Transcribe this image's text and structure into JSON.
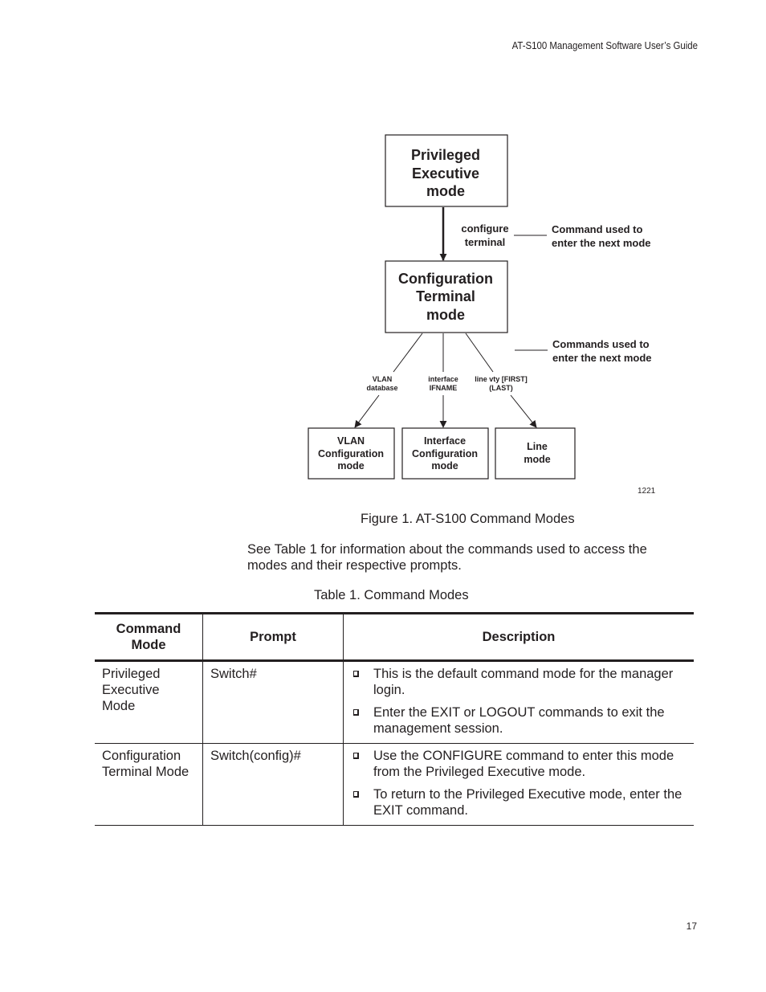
{
  "header": {
    "title": "AT-S100 Management Software User’s Guide"
  },
  "diagram": {
    "nodes": {
      "privileged": [
        "Privileged",
        "Executive",
        "mode"
      ],
      "config_terminal": [
        "Configuration",
        "Terminal",
        "mode"
      ],
      "vlan": [
        "VLAN",
        "Configuration",
        "mode"
      ],
      "interface": [
        "Interface",
        "Configuration",
        "mode"
      ],
      "line": [
        "Line",
        "mode"
      ]
    },
    "edge_labels": {
      "configure_terminal": [
        "configure",
        "terminal"
      ],
      "vlan_database": [
        "VLAN",
        "database"
      ],
      "interface_ifname": [
        "interface",
        "IFNAME"
      ],
      "line_vty": [
        "line vty [FIRST]",
        "(LAST)"
      ]
    },
    "annotations": {
      "single": [
        "Command used to",
        "enter the next mode"
      ],
      "plural": [
        "Commands used to",
        "enter the next mode"
      ]
    },
    "figure_id": "1221"
  },
  "figure_caption": "Figure 1. AT-S100 Command Modes",
  "paragraph": "See Table 1 for information about the commands used to access the modes and their respective prompts.",
  "table_caption": "Table 1. Command Modes",
  "table": {
    "headers": [
      "Command Mode",
      "Prompt",
      "Description"
    ],
    "rows": [
      {
        "mode": "Privileged Executive Mode",
        "prompt": "Switch#",
        "description": [
          "This is the default command mode for the manager login.",
          "Enter the EXIT or LOGOUT commands to exit the management session."
        ]
      },
      {
        "mode": "Configuration Terminal Mode",
        "prompt": "Switch(config)#",
        "description": [
          "Use the CONFIGURE command to enter this mode from the Privileged Executive mode.",
          "To return to the Privileged Executive mode, enter the EXIT command."
        ]
      }
    ]
  },
  "page_number": "17"
}
